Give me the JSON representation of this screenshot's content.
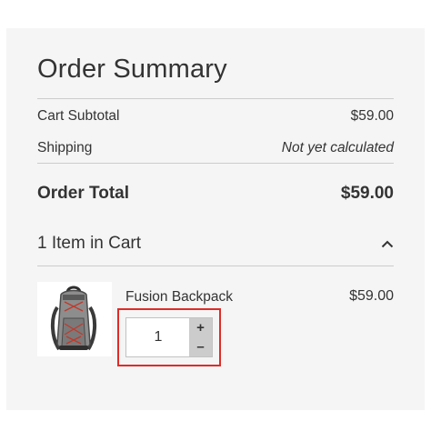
{
  "summary": {
    "title": "Order Summary",
    "subtotal_label": "Cart Subtotal",
    "subtotal_value": "$59.00",
    "shipping_label": "Shipping",
    "shipping_value": "Not yet calculated",
    "total_label": "Order Total",
    "total_value": "$59.00"
  },
  "items": {
    "title": "1 Item in Cart",
    "toggle_icon": "chevron-up-icon",
    "list": [
      {
        "name": "Fusion Backpack",
        "price": "$59.00",
        "quantity": "1",
        "image_icon": "backpack-image",
        "increment_label": "+",
        "decrement_label": "–"
      }
    ]
  },
  "colors": {
    "panel_bg": "#f5f5f5",
    "highlight": "#e02b27",
    "stepper_bg": "#cccccc"
  }
}
